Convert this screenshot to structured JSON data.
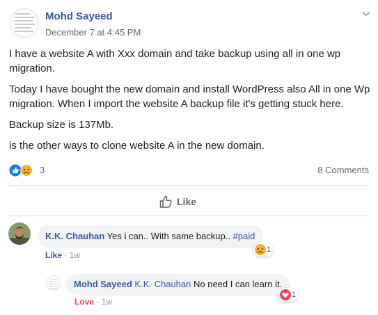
{
  "post": {
    "author": "Mohd Sayeed",
    "timestamp": "December 7 at 4:45 PM",
    "paragraphs": [
      "I have a website A with Xxx domain and take backup using all in one wp\nmigration.",
      "Today I have bought the new domain and install WordPress also All in one Wp\nmigration. When I import the website A backup file it's getting stuck here.",
      "Backup size is 137Mb.",
      "is the other ways to clone website A in the new domain."
    ],
    "reaction_icons": [
      "like-icon",
      "sad-icon"
    ],
    "reaction_count": "3",
    "comments_count": "8 Comments",
    "like_button_label": "Like"
  },
  "comments": [
    {
      "author": "K.K. Chauhan",
      "text": "Yes i can.. With same backup.. ",
      "hashtag": "#paid",
      "reaction_icon": "sad-icon",
      "reaction_count": "1",
      "action": "Like",
      "separator": " · ",
      "time": "1w"
    },
    {
      "author": "Mohd Sayeed",
      "mention": "K.K. Chauhan",
      "text": " No need I can learn it.",
      "reaction_icon": "love-icon",
      "reaction_count": "1",
      "action": "Love",
      "separator": " · ",
      "time": "1w"
    }
  ],
  "colors": {
    "link_blue": "#385898",
    "like_blue": "#1877f2",
    "love_red": "#f33e58",
    "sad_yellow": "#f7b125",
    "muted_text": "#606770",
    "bubble_bg": "#f2f3f5"
  }
}
